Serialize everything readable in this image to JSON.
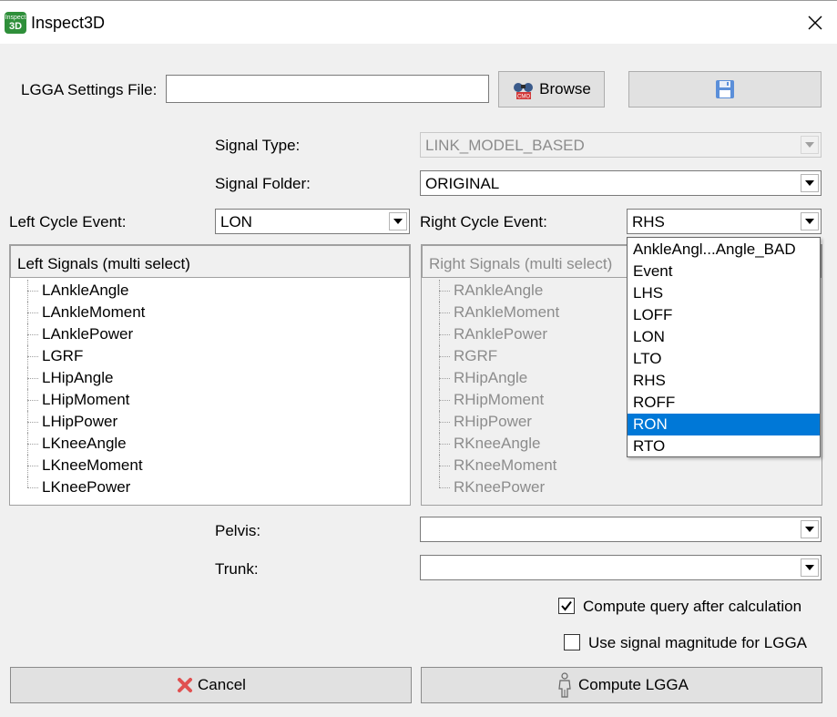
{
  "window": {
    "title": "Inspect3D",
    "icon_text_top": "Inspect",
    "icon_text_bottom": "3D"
  },
  "settings_file": {
    "label": "LGGA Settings File:",
    "value": "",
    "browse_label": "Browse",
    "browse_badge": "CMO"
  },
  "signal_type": {
    "label": "Signal Type:",
    "value": "LINK_MODEL_BASED"
  },
  "signal_folder": {
    "label": "Signal Folder:",
    "value": "ORIGINAL"
  },
  "left_cycle_event": {
    "label": "Left Cycle Event:",
    "value": "LON"
  },
  "right_cycle_event": {
    "label": "Right Cycle Event:",
    "value": "RHS",
    "options": [
      "AnkleAngl...Angle_BAD",
      "Event",
      "LHS",
      "LOFF",
      "LON",
      "LTO",
      "RHS",
      "ROFF",
      "RON",
      "RTO"
    ],
    "highlighted": "RON"
  },
  "left_signals": {
    "header": "Left Signals (multi select)",
    "items": [
      "LAnkleAngle",
      "LAnkleMoment",
      "LAnklePower",
      "LGRF",
      "LHipAngle",
      "LHipMoment",
      "LHipPower",
      "LKneeAngle",
      "LKneeMoment",
      "LKneePower"
    ]
  },
  "right_signals": {
    "header": "Right Signals (multi select)",
    "items": [
      "RAnkleAngle",
      "RAnkleMoment",
      "RAnklePower",
      "RGRF",
      "RHipAngle",
      "RHipMoment",
      "RHipPower",
      "RKneeAngle",
      "RKneeMoment",
      "RKneePower"
    ]
  },
  "pelvis": {
    "label": "Pelvis:",
    "value": ""
  },
  "trunk": {
    "label": "Trunk:",
    "value": ""
  },
  "options": {
    "compute_query_label": "Compute query after calculation",
    "compute_query_checked": true,
    "signal_magnitude_label": "Use signal magnitude for LGGA",
    "signal_magnitude_checked": false
  },
  "buttons": {
    "cancel_label": "Cancel",
    "compute_label": "Compute LGGA"
  },
  "colors": {
    "selection": "#0078d7",
    "app_icon": "#2f8f3a",
    "cancel_icon": "#e05050",
    "save_icon": "#5b8fd9"
  }
}
